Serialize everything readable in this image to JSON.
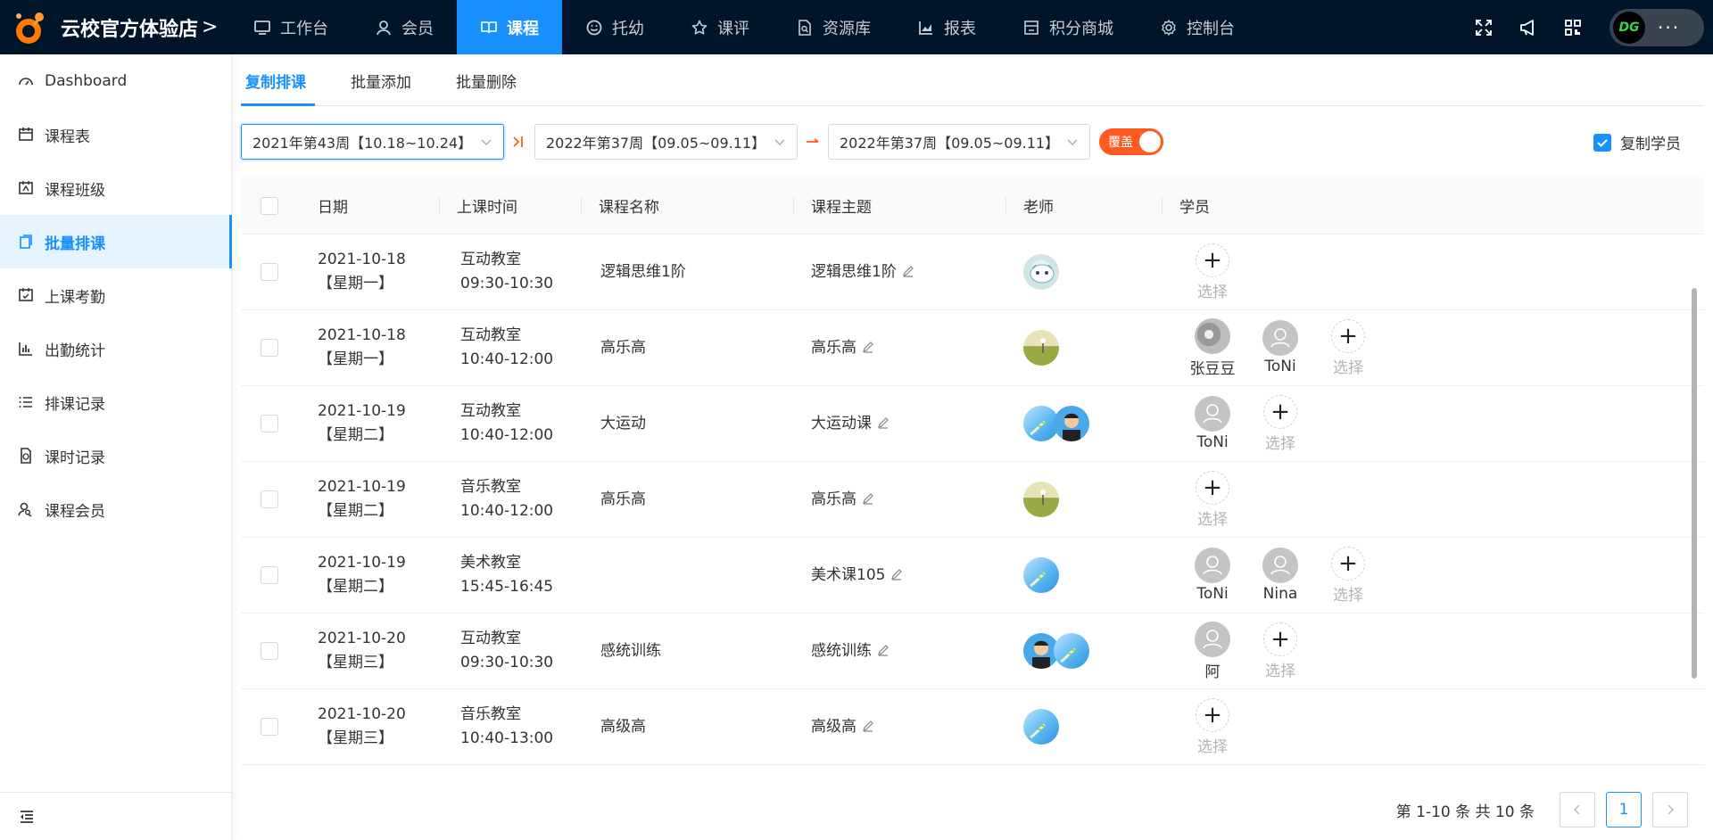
{
  "brand": {
    "name": "云校官方体验店",
    "arrow": ">"
  },
  "nav": [
    {
      "label": "工作台",
      "icon": "monitor-icon"
    },
    {
      "label": "会员",
      "icon": "user-icon"
    },
    {
      "label": "课程",
      "icon": "book-icon",
      "active": true
    },
    {
      "label": "托幼",
      "icon": "smile-icon"
    },
    {
      "label": "课评",
      "icon": "star-icon"
    },
    {
      "label": "资源库",
      "icon": "file-search-icon"
    },
    {
      "label": "报表",
      "icon": "chart-icon"
    },
    {
      "label": "积分商城",
      "icon": "shop-icon"
    },
    {
      "label": "控制台",
      "icon": "gear-icon"
    }
  ],
  "user": {
    "avatar_text": "DG",
    "more": "···"
  },
  "sidebar": {
    "items": [
      {
        "label": "Dashboard"
      },
      {
        "label": "课程表"
      },
      {
        "label": "课程班级"
      },
      {
        "label": "批量排课",
        "active": true
      },
      {
        "label": "上课考勤"
      },
      {
        "label": "出勤统计"
      },
      {
        "label": "排课记录"
      },
      {
        "label": "课时记录"
      },
      {
        "label": "课程会员"
      }
    ]
  },
  "subtabs": [
    {
      "label": "复制排课",
      "active": true
    },
    {
      "label": "批量添加"
    },
    {
      "label": "批量删除"
    }
  ],
  "filters": {
    "source_week": "2021年第43周【10.18~10.24】",
    "target_start": "2022年第37周【09.05~09.11】",
    "target_end": "2022年第37周【09.05~09.11】",
    "toggle_label": "覆盖",
    "copy_students_label": "复制学员"
  },
  "table": {
    "headers": {
      "date": "日期",
      "time": "上课时间",
      "course": "课程名称",
      "topic": "课程主题",
      "teacher": "老师",
      "students": "学员"
    },
    "select_label": "选择",
    "rows": [
      {
        "date": "2021-10-18",
        "weekday": "【星期一】",
        "room": "互动教室",
        "time": "09:30-10:30",
        "course": "逻辑思维1阶",
        "topic": "逻辑思维1阶",
        "teachers": [
          "robot"
        ],
        "students": []
      },
      {
        "date": "2021-10-18",
        "weekday": "【星期一】",
        "room": "互动教室",
        "time": "10:40-12:00",
        "course": "高乐高",
        "topic": "高乐高",
        "teachers": [
          "meadow"
        ],
        "students": [
          {
            "name": "张豆豆",
            "photo": true
          },
          {
            "name": "ToNi"
          }
        ]
      },
      {
        "date": "2021-10-19",
        "weekday": "【星期二】",
        "room": "互动教室",
        "time": "10:40-12:00",
        "course": "大运动",
        "topic": "大运动课",
        "teachers": [
          "sky",
          "man"
        ],
        "students": [
          {
            "name": "ToNi"
          }
        ]
      },
      {
        "date": "2021-10-19",
        "weekday": "【星期二】",
        "room": "音乐教室",
        "time": "10:40-12:00",
        "course": "高乐高",
        "topic": "高乐高",
        "teachers": [
          "meadow"
        ],
        "students": []
      },
      {
        "date": "2021-10-19",
        "weekday": "【星期二】",
        "room": "美术教室",
        "time": "15:45-16:45",
        "course": "",
        "topic": "美术课105",
        "teachers": [
          "sky"
        ],
        "students": [
          {
            "name": "ToNi"
          },
          {
            "name": "Nina"
          }
        ]
      },
      {
        "date": "2021-10-20",
        "weekday": "【星期三】",
        "room": "互动教室",
        "time": "09:30-10:30",
        "course": "感统训练",
        "topic": "感统训练",
        "teachers": [
          "man",
          "sky"
        ],
        "students": [
          {
            "name": "阿"
          }
        ]
      },
      {
        "date": "2021-10-20",
        "weekday": "【星期三】",
        "room": "音乐教室",
        "time": "10:40-13:00",
        "course": "高级高",
        "topic": "高级高",
        "teachers": [
          "sky"
        ],
        "students": []
      }
    ]
  },
  "pager": {
    "text": "第 1-10 条 共 10 条",
    "current": "1"
  }
}
